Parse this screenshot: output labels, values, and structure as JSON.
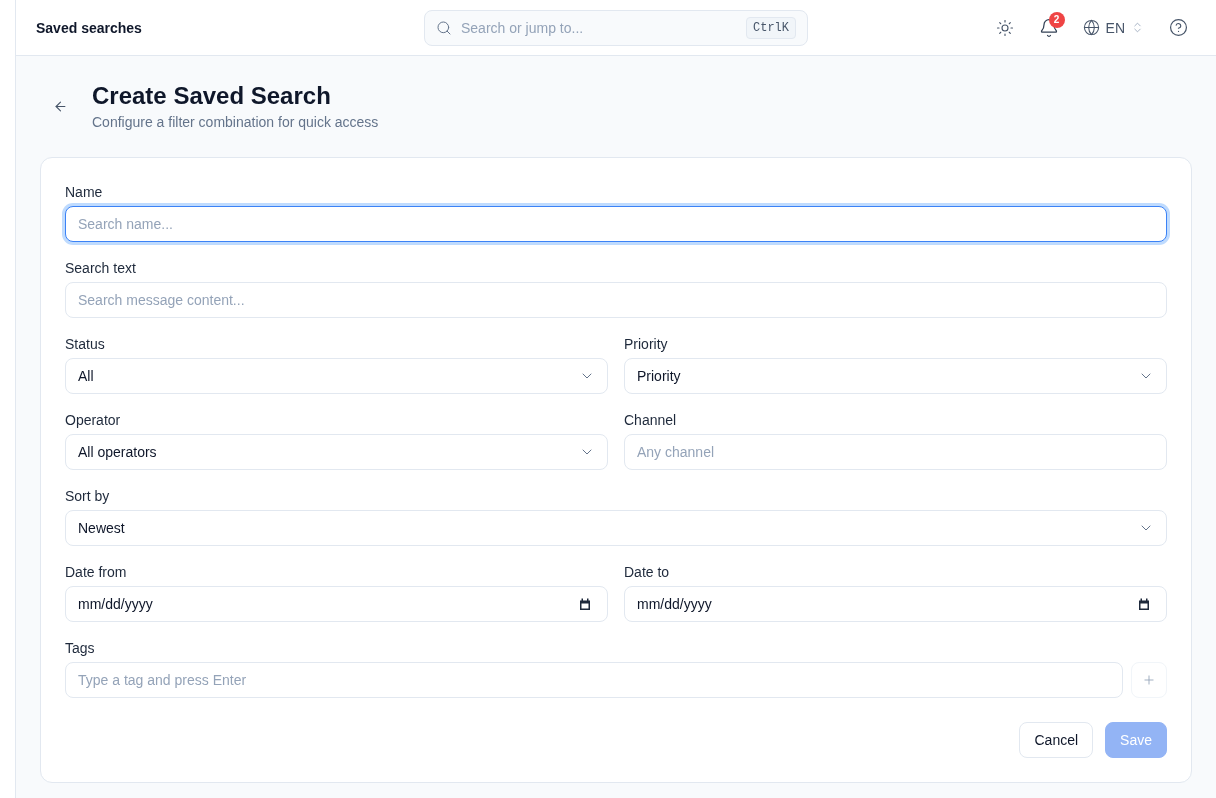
{
  "header": {
    "title": "Saved searches",
    "search": {
      "placeholder": "Search or jump to...",
      "shortcut": "CtrlK"
    },
    "notifications": {
      "count": "2"
    },
    "language": "EN"
  },
  "page": {
    "title": "Create Saved Search",
    "subtitle": "Configure a filter combination for quick access"
  },
  "form": {
    "rows": [
      {
        "fields": [
          {
            "kind": "text",
            "label": "Name",
            "placeholder": "Search name...",
            "focused": true
          }
        ]
      },
      {
        "fields": [
          {
            "kind": "text",
            "label": "Search text",
            "placeholder": "Search message content...",
            "focused": false
          }
        ]
      },
      {
        "fields": [
          {
            "kind": "select",
            "label": "Status",
            "value": "All",
            "focused": false
          },
          {
            "kind": "select",
            "label": "Priority",
            "value": "Priority",
            "focused": false
          }
        ]
      },
      {
        "fields": [
          {
            "kind": "select",
            "label": "Operator",
            "value": "All operators",
            "focused": false
          },
          {
            "kind": "text",
            "label": "Channel",
            "placeholder": "Any channel",
            "focused": false
          }
        ]
      },
      {
        "fields": [
          {
            "kind": "select",
            "label": "Sort by",
            "value": "Newest",
            "focused": false
          }
        ]
      },
      {
        "fields": [
          {
            "kind": "date",
            "label": "Date from",
            "value": "mm/dd/yyyy",
            "focused": false
          },
          {
            "kind": "date",
            "label": "Date to",
            "value": "mm/dd/yyyy",
            "focused": false
          }
        ]
      },
      {
        "fields": [
          {
            "kind": "tags",
            "label": "Tags",
            "placeholder": "Type a tag and press Enter",
            "focused": false
          }
        ]
      }
    ],
    "actions": [
      {
        "kind": "secondary",
        "label": "Cancel",
        "disabled": false
      },
      {
        "kind": "primary",
        "label": "Save",
        "disabled": true
      }
    ]
  }
}
